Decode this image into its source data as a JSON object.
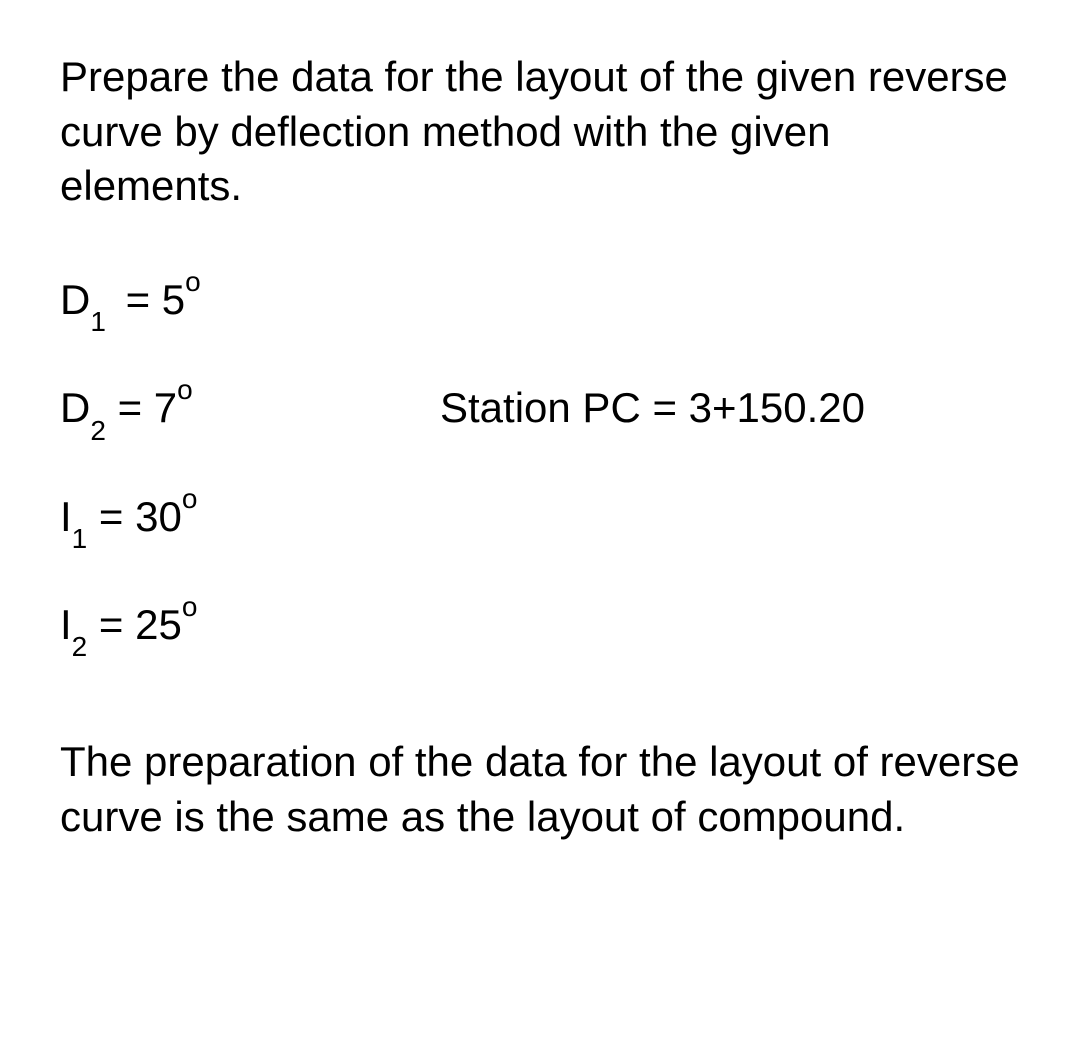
{
  "intro": "Prepare the data for the layout of the given reverse curve by deflection method with the given elements.",
  "eq1": {
    "var": "D",
    "sub": "1",
    "eq": " = ",
    "val": "5",
    "sup": "o"
  },
  "eq2": {
    "var": "D",
    "sub": "2",
    "eq": " = ",
    "val": "7",
    "sup": "o"
  },
  "station": "Station PC = 3+150.20",
  "eq3": {
    "var": "I",
    "sub": "1",
    "eq": " = ",
    "val": "30",
    "sup": "o"
  },
  "eq4": {
    "var": "I",
    "sub": "2",
    "eq": " = ",
    "val": "25",
    "sup": "o"
  },
  "footer": "The preparation of the data for the layout of reverse curve is the same as the layout of compound."
}
